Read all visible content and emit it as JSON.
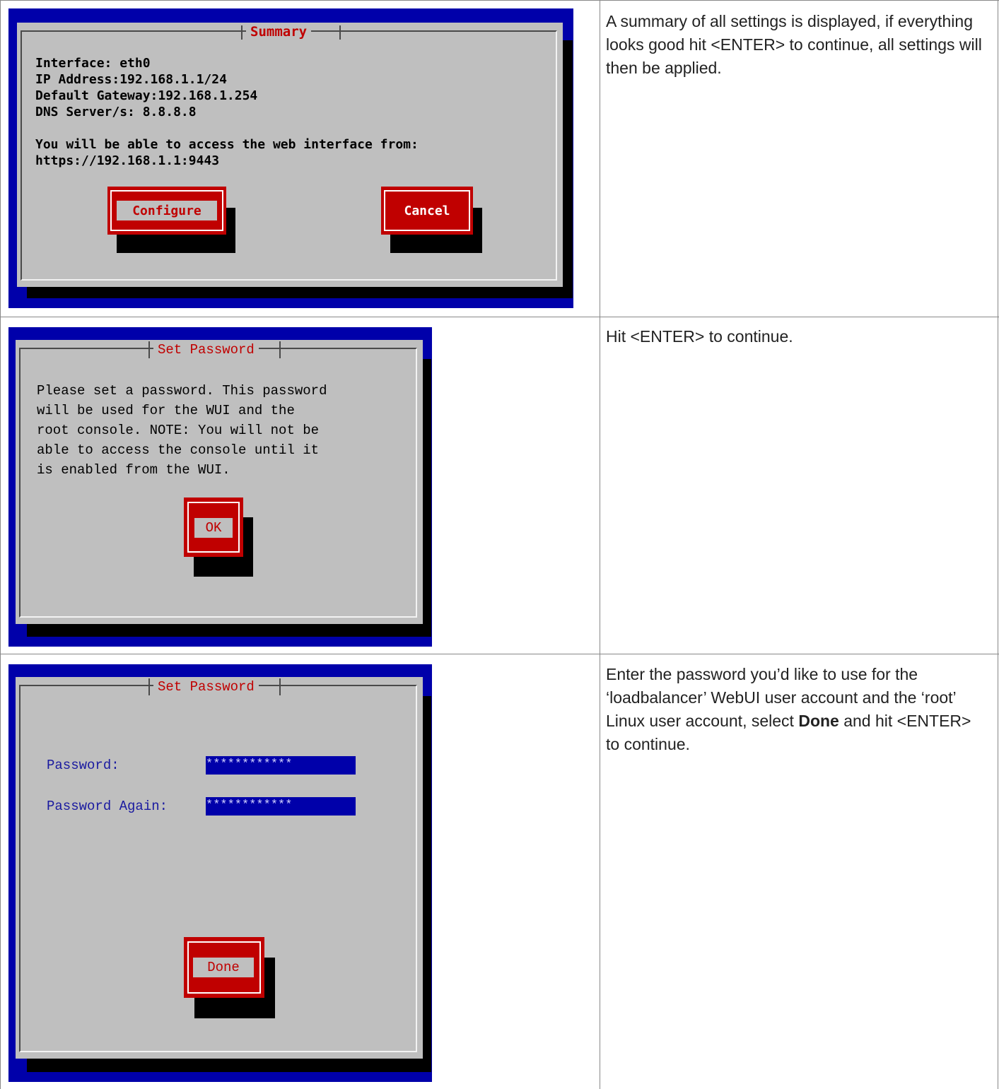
{
  "rows": [
    {
      "dialog_title": "Summary",
      "lines": [
        "Interface: eth0",
        "IP Address:192.168.1.1/24",
        "Default Gateway:192.168.1.254",
        "DNS Server/s: 8.8.8.8",
        "",
        "You will be able to access the web interface from:",
        "https://192.168.1.1:9443"
      ],
      "buttons": [
        "Configure",
        "Cancel"
      ],
      "description": "A summary of all settings is displayed, if everything looks good hit <ENTER> to continue, all settings will then be applied."
    },
    {
      "dialog_title": "Set Password",
      "lines": [
        "Please set a password. This password",
        "will be used for the WUI and the",
        "root console. NOTE: You will not be",
        "able to access the console until it",
        "is enabled from the WUI."
      ],
      "buttons": [
        "OK"
      ],
      "description": "Hit <ENTER> to continue."
    },
    {
      "dialog_title": "Set Password",
      "fields": [
        {
          "label": "Password:",
          "value": "************"
        },
        {
          "label": "Password Again:",
          "value": "************"
        }
      ],
      "buttons": [
        "Done"
      ],
      "description_parts": {
        "before": "Enter the password you’d like to use for the ‘loadbalancer’ WebUI user account and the ‘root’ Linux user account, select ",
        "bold": "Done",
        "after": " and hit <ENTER> to continue."
      }
    }
  ],
  "colors": {
    "screen_bg": "#0000aa",
    "dialog_bg": "#bfbfbf",
    "accent_red": "#c00000",
    "field_bg": "#0000aa"
  }
}
